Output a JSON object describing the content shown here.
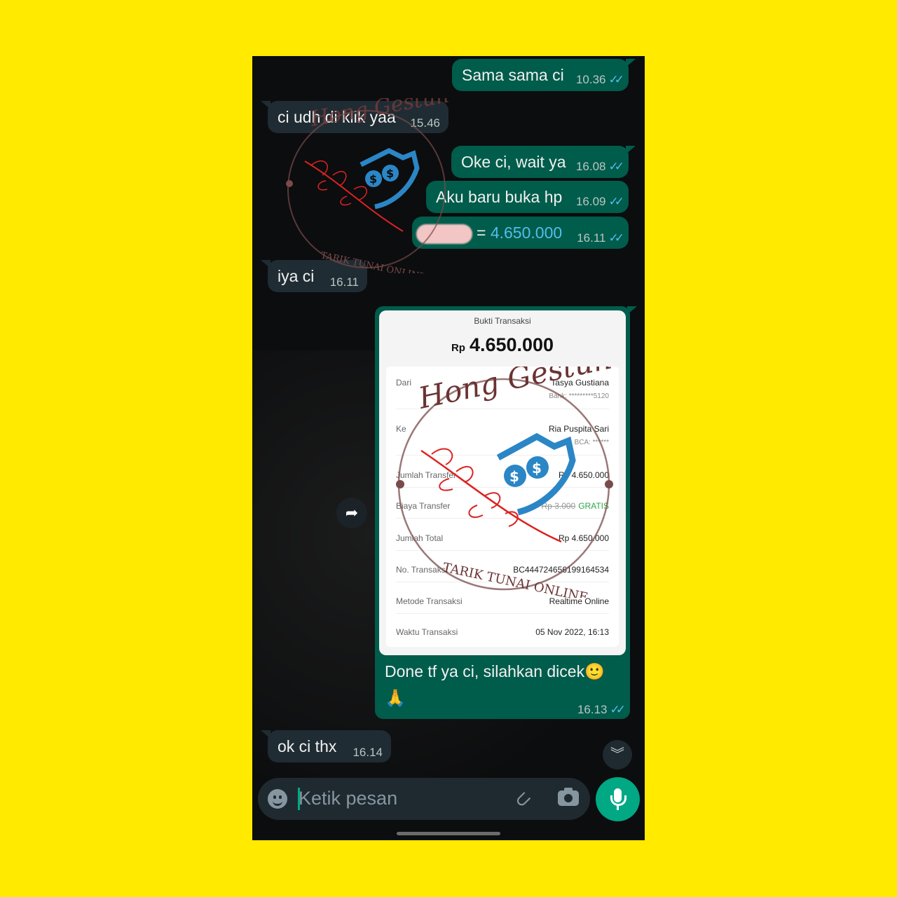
{
  "messages": [
    {
      "id": "m1",
      "dir": "out",
      "text": "Sama sama ci",
      "time": "10.36"
    },
    {
      "id": "m2",
      "dir": "in",
      "text": "ci udh di klik yaa",
      "time": "15.46"
    },
    {
      "id": "m3",
      "dir": "out",
      "text": "Oke ci, wait ya",
      "time": "16.08"
    },
    {
      "id": "m4",
      "dir": "out",
      "text": "Aku baru buka hp",
      "time": "16.09"
    },
    {
      "id": "m5",
      "dir": "out",
      "text_prefix": "=",
      "amount": "4.650.000",
      "time": "16.11"
    },
    {
      "id": "m6",
      "dir": "in",
      "text": "iya ci",
      "time": "16.11"
    },
    {
      "id": "m7",
      "dir": "out",
      "caption": "Done tf ya ci, silahkan dicek🙂",
      "caption_line2": "🙏",
      "time": "16.13"
    },
    {
      "id": "m8",
      "dir": "in",
      "text": "ok ci thx",
      "time": "16.14"
    }
  ],
  "receipt": {
    "title": "Bukti Transaksi",
    "currency": "Rp",
    "amount": "4.650.000",
    "rows": {
      "from_label": "Dari",
      "from_value": "Tasya Gustiana",
      "from_sub": "Bank: *********5120",
      "to_label": "Ke",
      "to_value": "Ria Puspita Sari",
      "to_sub": "BCA: ******",
      "amount_label": "Jumlah Transfer",
      "amount_value": "Rp 4.650.000",
      "fee_label": "Biaya Transfer",
      "fee_old": "Rp 3.000",
      "fee_value": "GRATIS",
      "total_label": "Jumlah Total",
      "total_value": "Rp 4.650.000",
      "txno_label": "No. Transaksi",
      "txno_value": "BC444724656199164534",
      "method_label": "Metode Transaksi",
      "method_value": "Realtime Online",
      "time_label": "Waktu Transaksi",
      "time_value": "05 Nov 2022, 16:13"
    }
  },
  "watermark": {
    "script": "Hong Gestun",
    "ring": "TARIK TUNAI ONLINE"
  },
  "input": {
    "placeholder": "Ketik pesan"
  },
  "icons": {
    "read_ticks": "double-check-icon",
    "forward": "forward-icon",
    "scroll_down": "chevron-double-down-icon",
    "emoji": "emoji-icon",
    "attach": "paperclip-icon",
    "camera": "camera-icon",
    "mic": "microphone-icon"
  },
  "colors": {
    "background": "#FFEA00",
    "chat_bg": "#0c0d0e",
    "bubble_out": "#005c4b",
    "bubble_in": "#202c33",
    "accent": "#00a884",
    "tick": "#53bdeb"
  }
}
